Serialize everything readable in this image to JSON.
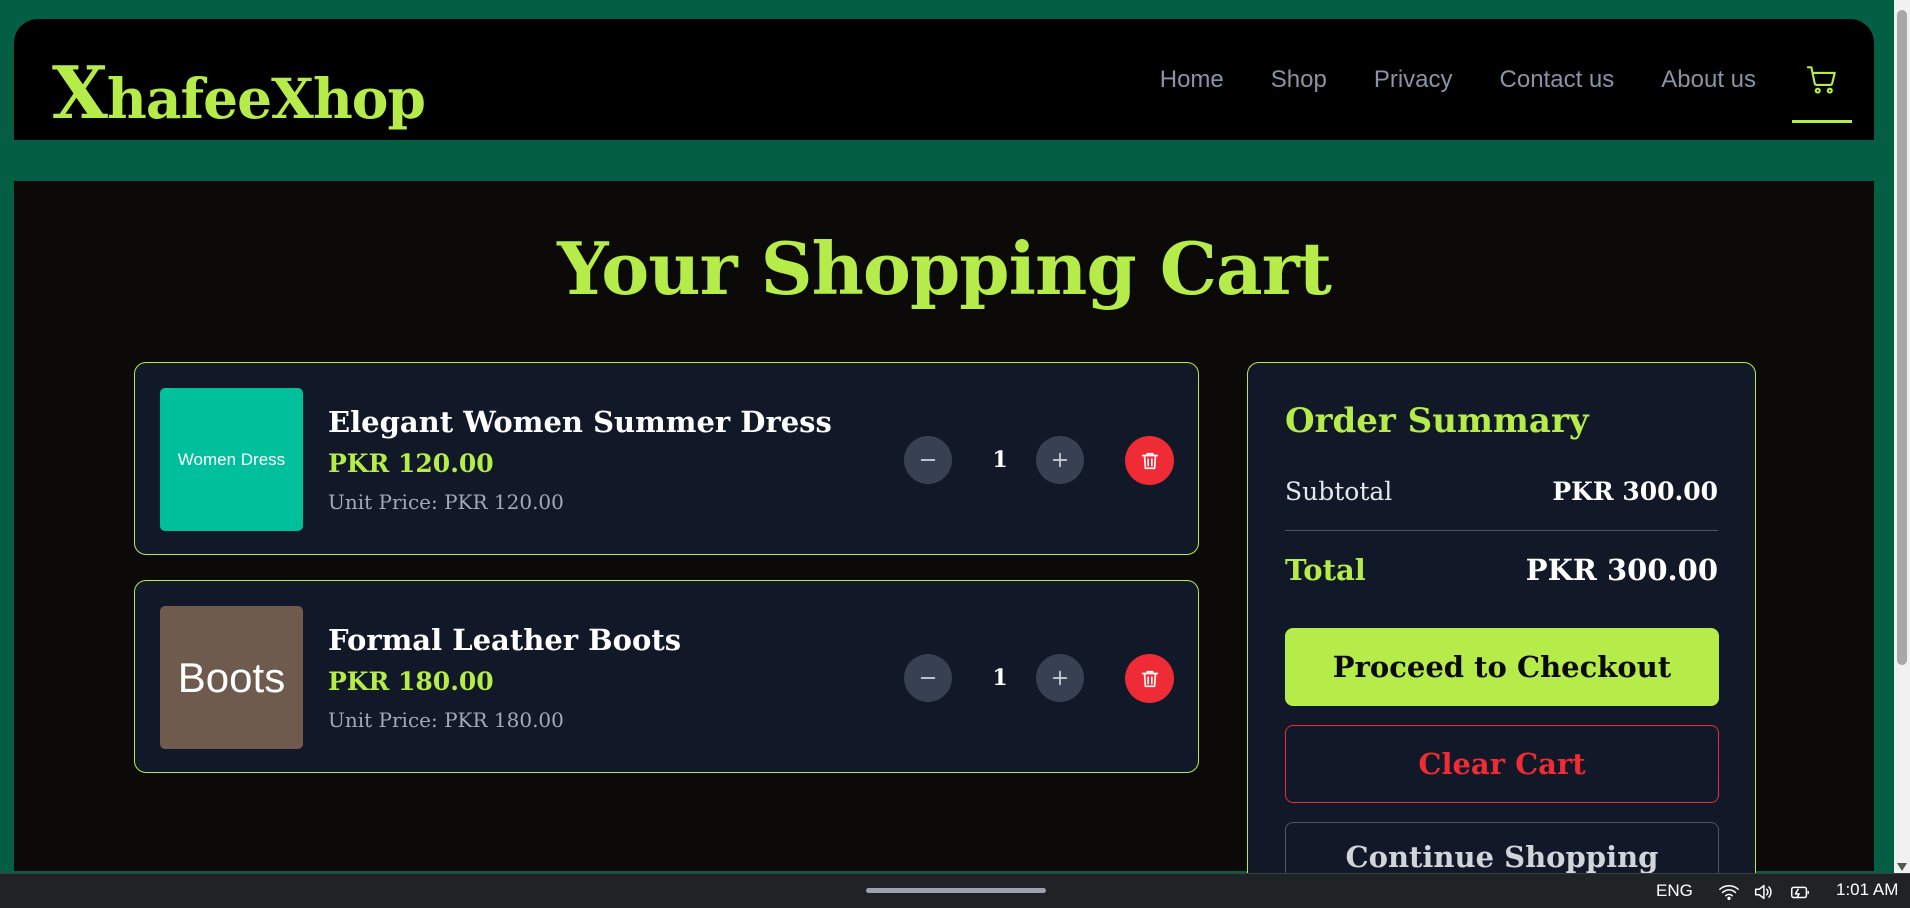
{
  "brand": {
    "logo_first": "X",
    "logo_rest": "hafeeXhop"
  },
  "nav": {
    "items": [
      "Home",
      "Shop",
      "Privacy",
      "Contact us",
      "About us"
    ]
  },
  "colors": {
    "accent": "#b6ec4a",
    "frame": "#035e43",
    "card": "#111827",
    "danger": "#ef2b35"
  },
  "page": {
    "title": "Your Shopping Cart"
  },
  "cart": {
    "items": [
      {
        "thumb_text": "Women Dress",
        "thumb_color": "#00c09c",
        "name": "Elegant Women Summer Dress",
        "price": "PKR 120.00",
        "unit": "Unit Price: PKR 120.00",
        "qty": "1"
      },
      {
        "thumb_text": "Boots",
        "thumb_color": "#6e5b4d",
        "name": "Formal Leather Boots",
        "price": "PKR 180.00",
        "unit": "Unit Price: PKR 180.00",
        "qty": "1"
      }
    ]
  },
  "summary": {
    "title": "Order Summary",
    "subtotal_label": "Subtotal",
    "subtotal_value": "PKR 300.00",
    "total_label": "Total",
    "total_value": "PKR 300.00",
    "checkout": "Proceed to Checkout",
    "clear": "Clear Cart",
    "continue": "Continue Shopping"
  },
  "taskbar": {
    "lang": "ENG",
    "time": "1:01 AM"
  },
  "icons": [
    "cart-icon",
    "minus-icon",
    "plus-icon",
    "trash-icon",
    "wifi-icon",
    "volume-icon",
    "battery-icon"
  ]
}
